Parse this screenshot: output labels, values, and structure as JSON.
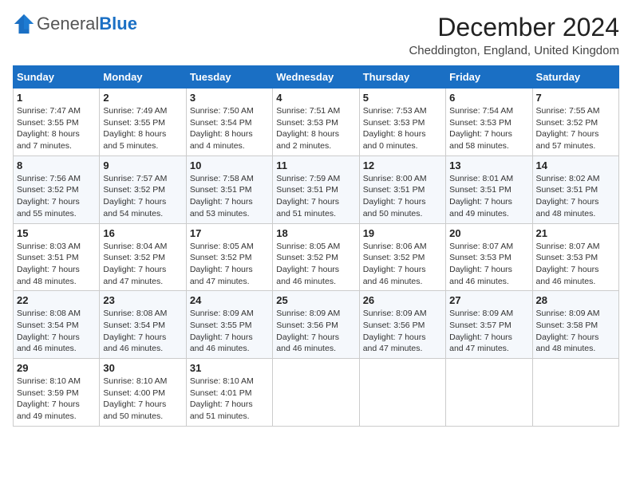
{
  "logo": {
    "general": "General",
    "blue": "Blue"
  },
  "title": "December 2024",
  "location": "Cheddington, England, United Kingdom",
  "days_header": [
    "Sunday",
    "Monday",
    "Tuesday",
    "Wednesday",
    "Thursday",
    "Friday",
    "Saturday"
  ],
  "weeks": [
    [
      {
        "day": "1",
        "info": "Sunrise: 7:47 AM\nSunset: 3:55 PM\nDaylight: 8 hours\nand 7 minutes."
      },
      {
        "day": "2",
        "info": "Sunrise: 7:49 AM\nSunset: 3:55 PM\nDaylight: 8 hours\nand 5 minutes."
      },
      {
        "day": "3",
        "info": "Sunrise: 7:50 AM\nSunset: 3:54 PM\nDaylight: 8 hours\nand 4 minutes."
      },
      {
        "day": "4",
        "info": "Sunrise: 7:51 AM\nSunset: 3:53 PM\nDaylight: 8 hours\nand 2 minutes."
      },
      {
        "day": "5",
        "info": "Sunrise: 7:53 AM\nSunset: 3:53 PM\nDaylight: 8 hours\nand 0 minutes."
      },
      {
        "day": "6",
        "info": "Sunrise: 7:54 AM\nSunset: 3:53 PM\nDaylight: 7 hours\nand 58 minutes."
      },
      {
        "day": "7",
        "info": "Sunrise: 7:55 AM\nSunset: 3:52 PM\nDaylight: 7 hours\nand 57 minutes."
      }
    ],
    [
      {
        "day": "8",
        "info": "Sunrise: 7:56 AM\nSunset: 3:52 PM\nDaylight: 7 hours\nand 55 minutes."
      },
      {
        "day": "9",
        "info": "Sunrise: 7:57 AM\nSunset: 3:52 PM\nDaylight: 7 hours\nand 54 minutes."
      },
      {
        "day": "10",
        "info": "Sunrise: 7:58 AM\nSunset: 3:51 PM\nDaylight: 7 hours\nand 53 minutes."
      },
      {
        "day": "11",
        "info": "Sunrise: 7:59 AM\nSunset: 3:51 PM\nDaylight: 7 hours\nand 51 minutes."
      },
      {
        "day": "12",
        "info": "Sunrise: 8:00 AM\nSunset: 3:51 PM\nDaylight: 7 hours\nand 50 minutes."
      },
      {
        "day": "13",
        "info": "Sunrise: 8:01 AM\nSunset: 3:51 PM\nDaylight: 7 hours\nand 49 minutes."
      },
      {
        "day": "14",
        "info": "Sunrise: 8:02 AM\nSunset: 3:51 PM\nDaylight: 7 hours\nand 48 minutes."
      }
    ],
    [
      {
        "day": "15",
        "info": "Sunrise: 8:03 AM\nSunset: 3:51 PM\nDaylight: 7 hours\nand 48 minutes."
      },
      {
        "day": "16",
        "info": "Sunrise: 8:04 AM\nSunset: 3:52 PM\nDaylight: 7 hours\nand 47 minutes."
      },
      {
        "day": "17",
        "info": "Sunrise: 8:05 AM\nSunset: 3:52 PM\nDaylight: 7 hours\nand 47 minutes."
      },
      {
        "day": "18",
        "info": "Sunrise: 8:05 AM\nSunset: 3:52 PM\nDaylight: 7 hours\nand 46 minutes."
      },
      {
        "day": "19",
        "info": "Sunrise: 8:06 AM\nSunset: 3:52 PM\nDaylight: 7 hours\nand 46 minutes."
      },
      {
        "day": "20",
        "info": "Sunrise: 8:07 AM\nSunset: 3:53 PM\nDaylight: 7 hours\nand 46 minutes."
      },
      {
        "day": "21",
        "info": "Sunrise: 8:07 AM\nSunset: 3:53 PM\nDaylight: 7 hours\nand 46 minutes."
      }
    ],
    [
      {
        "day": "22",
        "info": "Sunrise: 8:08 AM\nSunset: 3:54 PM\nDaylight: 7 hours\nand 46 minutes."
      },
      {
        "day": "23",
        "info": "Sunrise: 8:08 AM\nSunset: 3:54 PM\nDaylight: 7 hours\nand 46 minutes."
      },
      {
        "day": "24",
        "info": "Sunrise: 8:09 AM\nSunset: 3:55 PM\nDaylight: 7 hours\nand 46 minutes."
      },
      {
        "day": "25",
        "info": "Sunrise: 8:09 AM\nSunset: 3:56 PM\nDaylight: 7 hours\nand 46 minutes."
      },
      {
        "day": "26",
        "info": "Sunrise: 8:09 AM\nSunset: 3:56 PM\nDaylight: 7 hours\nand 47 minutes."
      },
      {
        "day": "27",
        "info": "Sunrise: 8:09 AM\nSunset: 3:57 PM\nDaylight: 7 hours\nand 47 minutes."
      },
      {
        "day": "28",
        "info": "Sunrise: 8:09 AM\nSunset: 3:58 PM\nDaylight: 7 hours\nand 48 minutes."
      }
    ],
    [
      {
        "day": "29",
        "info": "Sunrise: 8:10 AM\nSunset: 3:59 PM\nDaylight: 7 hours\nand 49 minutes."
      },
      {
        "day": "30",
        "info": "Sunrise: 8:10 AM\nSunset: 4:00 PM\nDaylight: 7 hours\nand 50 minutes."
      },
      {
        "day": "31",
        "info": "Sunrise: 8:10 AM\nSunset: 4:01 PM\nDaylight: 7 hours\nand 51 minutes."
      },
      null,
      null,
      null,
      null
    ]
  ]
}
